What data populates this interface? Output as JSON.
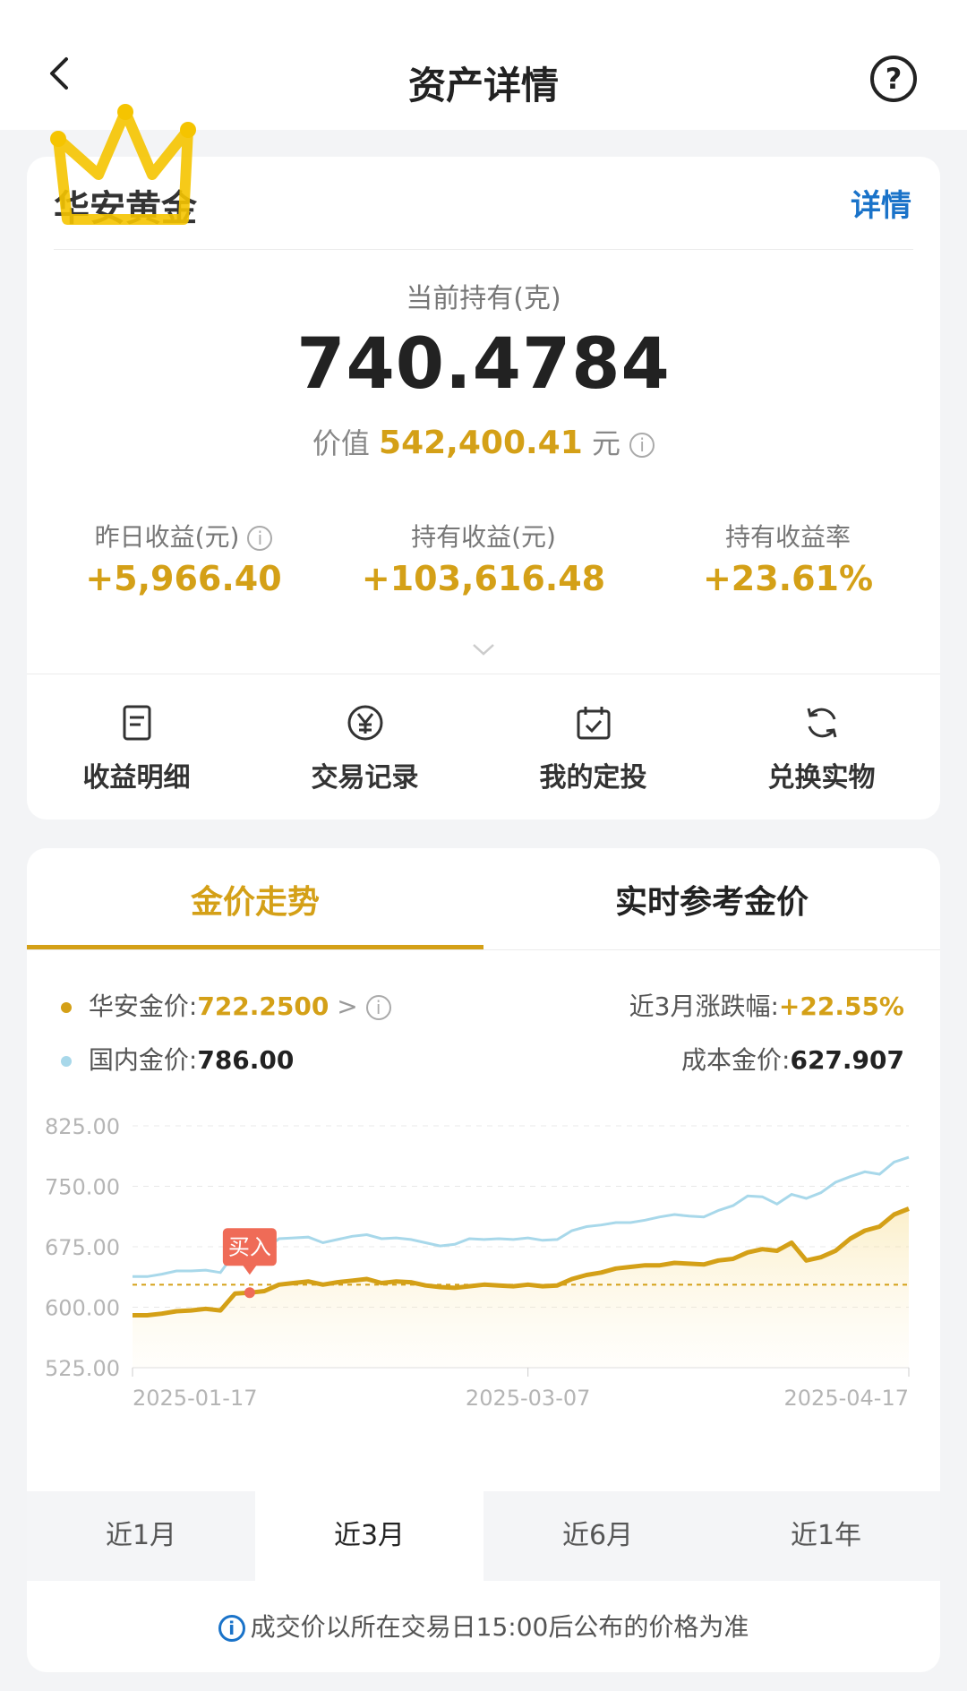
{
  "header": {
    "title": "资产详情"
  },
  "product": {
    "name": "华安黄金",
    "detail_link": "详情"
  },
  "holding": {
    "label": "当前持有(克)",
    "amount": "740.4784",
    "value_prefix": "价值",
    "value": "542,400.41",
    "value_unit": "元"
  },
  "stats": [
    {
      "label": "昨日收益(元)",
      "value": "+5,966.40"
    },
    {
      "label": "持有收益(元)",
      "value": "+103,616.48"
    },
    {
      "label": "持有收益率",
      "value": "+23.61%"
    }
  ],
  "actions": [
    {
      "label": "收益明细",
      "icon": "document-icon"
    },
    {
      "label": "交易记录",
      "icon": "yuan-icon"
    },
    {
      "label": "我的定投",
      "icon": "calendar-check-icon"
    },
    {
      "label": "兑换实物",
      "icon": "refresh-icon"
    }
  ],
  "tabs": {
    "active": "金价走势",
    "inactive": "实时参考金价"
  },
  "legend": {
    "huaan_label": "华安金价:",
    "huaan_value": "722.2500",
    "huaan_arrow": ">",
    "change_label": "近3月涨跌幅:",
    "change_value": "+22.55%",
    "domestic_label": "国内金价:",
    "domestic_value": "786.00",
    "cost_label": "成本金价:",
    "cost_value": "627.907"
  },
  "colors": {
    "gold": "#d4a017",
    "blue_line": "#a8d8ea",
    "marker": "#ef6b57"
  },
  "chart_data": {
    "type": "line",
    "ylim": [
      525,
      825
    ],
    "yticks": [
      "825.00",
      "750.00",
      "675.00",
      "600.00",
      "525.00"
    ],
    "ytick_values": [
      825,
      750,
      675,
      600,
      525
    ],
    "xticks": [
      "2025-01-17",
      "2025-03-07",
      "2025-04-17"
    ],
    "cost_line": 627.907,
    "buy_marker": {
      "label": "买入",
      "index": 8
    },
    "series": [
      {
        "name": "国内金价",
        "values": [
          638,
          638,
          641,
          645,
          645,
          646,
          643,
          668,
          669,
          671,
          685,
          686,
          687,
          680,
          684,
          688,
          690,
          685,
          686,
          684,
          680,
          676,
          678,
          685,
          684,
          685,
          684,
          686,
          683,
          684,
          695,
          700,
          702,
          705,
          705,
          708,
          712,
          715,
          713,
          712,
          720,
          726,
          738,
          737,
          728,
          740,
          735,
          742,
          755,
          762,
          768,
          765,
          780,
          786
        ]
      },
      {
        "name": "华安金价",
        "values": [
          590,
          590,
          592,
          595,
          596,
          598,
          596,
          617,
          618,
          620,
          628,
          630,
          632,
          628,
          631,
          633,
          635,
          630,
          632,
          631,
          627,
          625,
          624,
          626,
          628,
          627,
          626,
          628,
          626,
          627,
          635,
          640,
          643,
          648,
          650,
          652,
          652,
          655,
          654,
          653,
          658,
          660,
          668,
          672,
          670,
          680,
          658,
          662,
          670,
          685,
          695,
          700,
          715,
          722.25
        ]
      }
    ]
  },
  "ranges": [
    "近1月",
    "近3月",
    "近6月",
    "近1年"
  ],
  "active_range": "近3月",
  "footnote": "成交价以所在交易日15:00后公布的价格为准"
}
